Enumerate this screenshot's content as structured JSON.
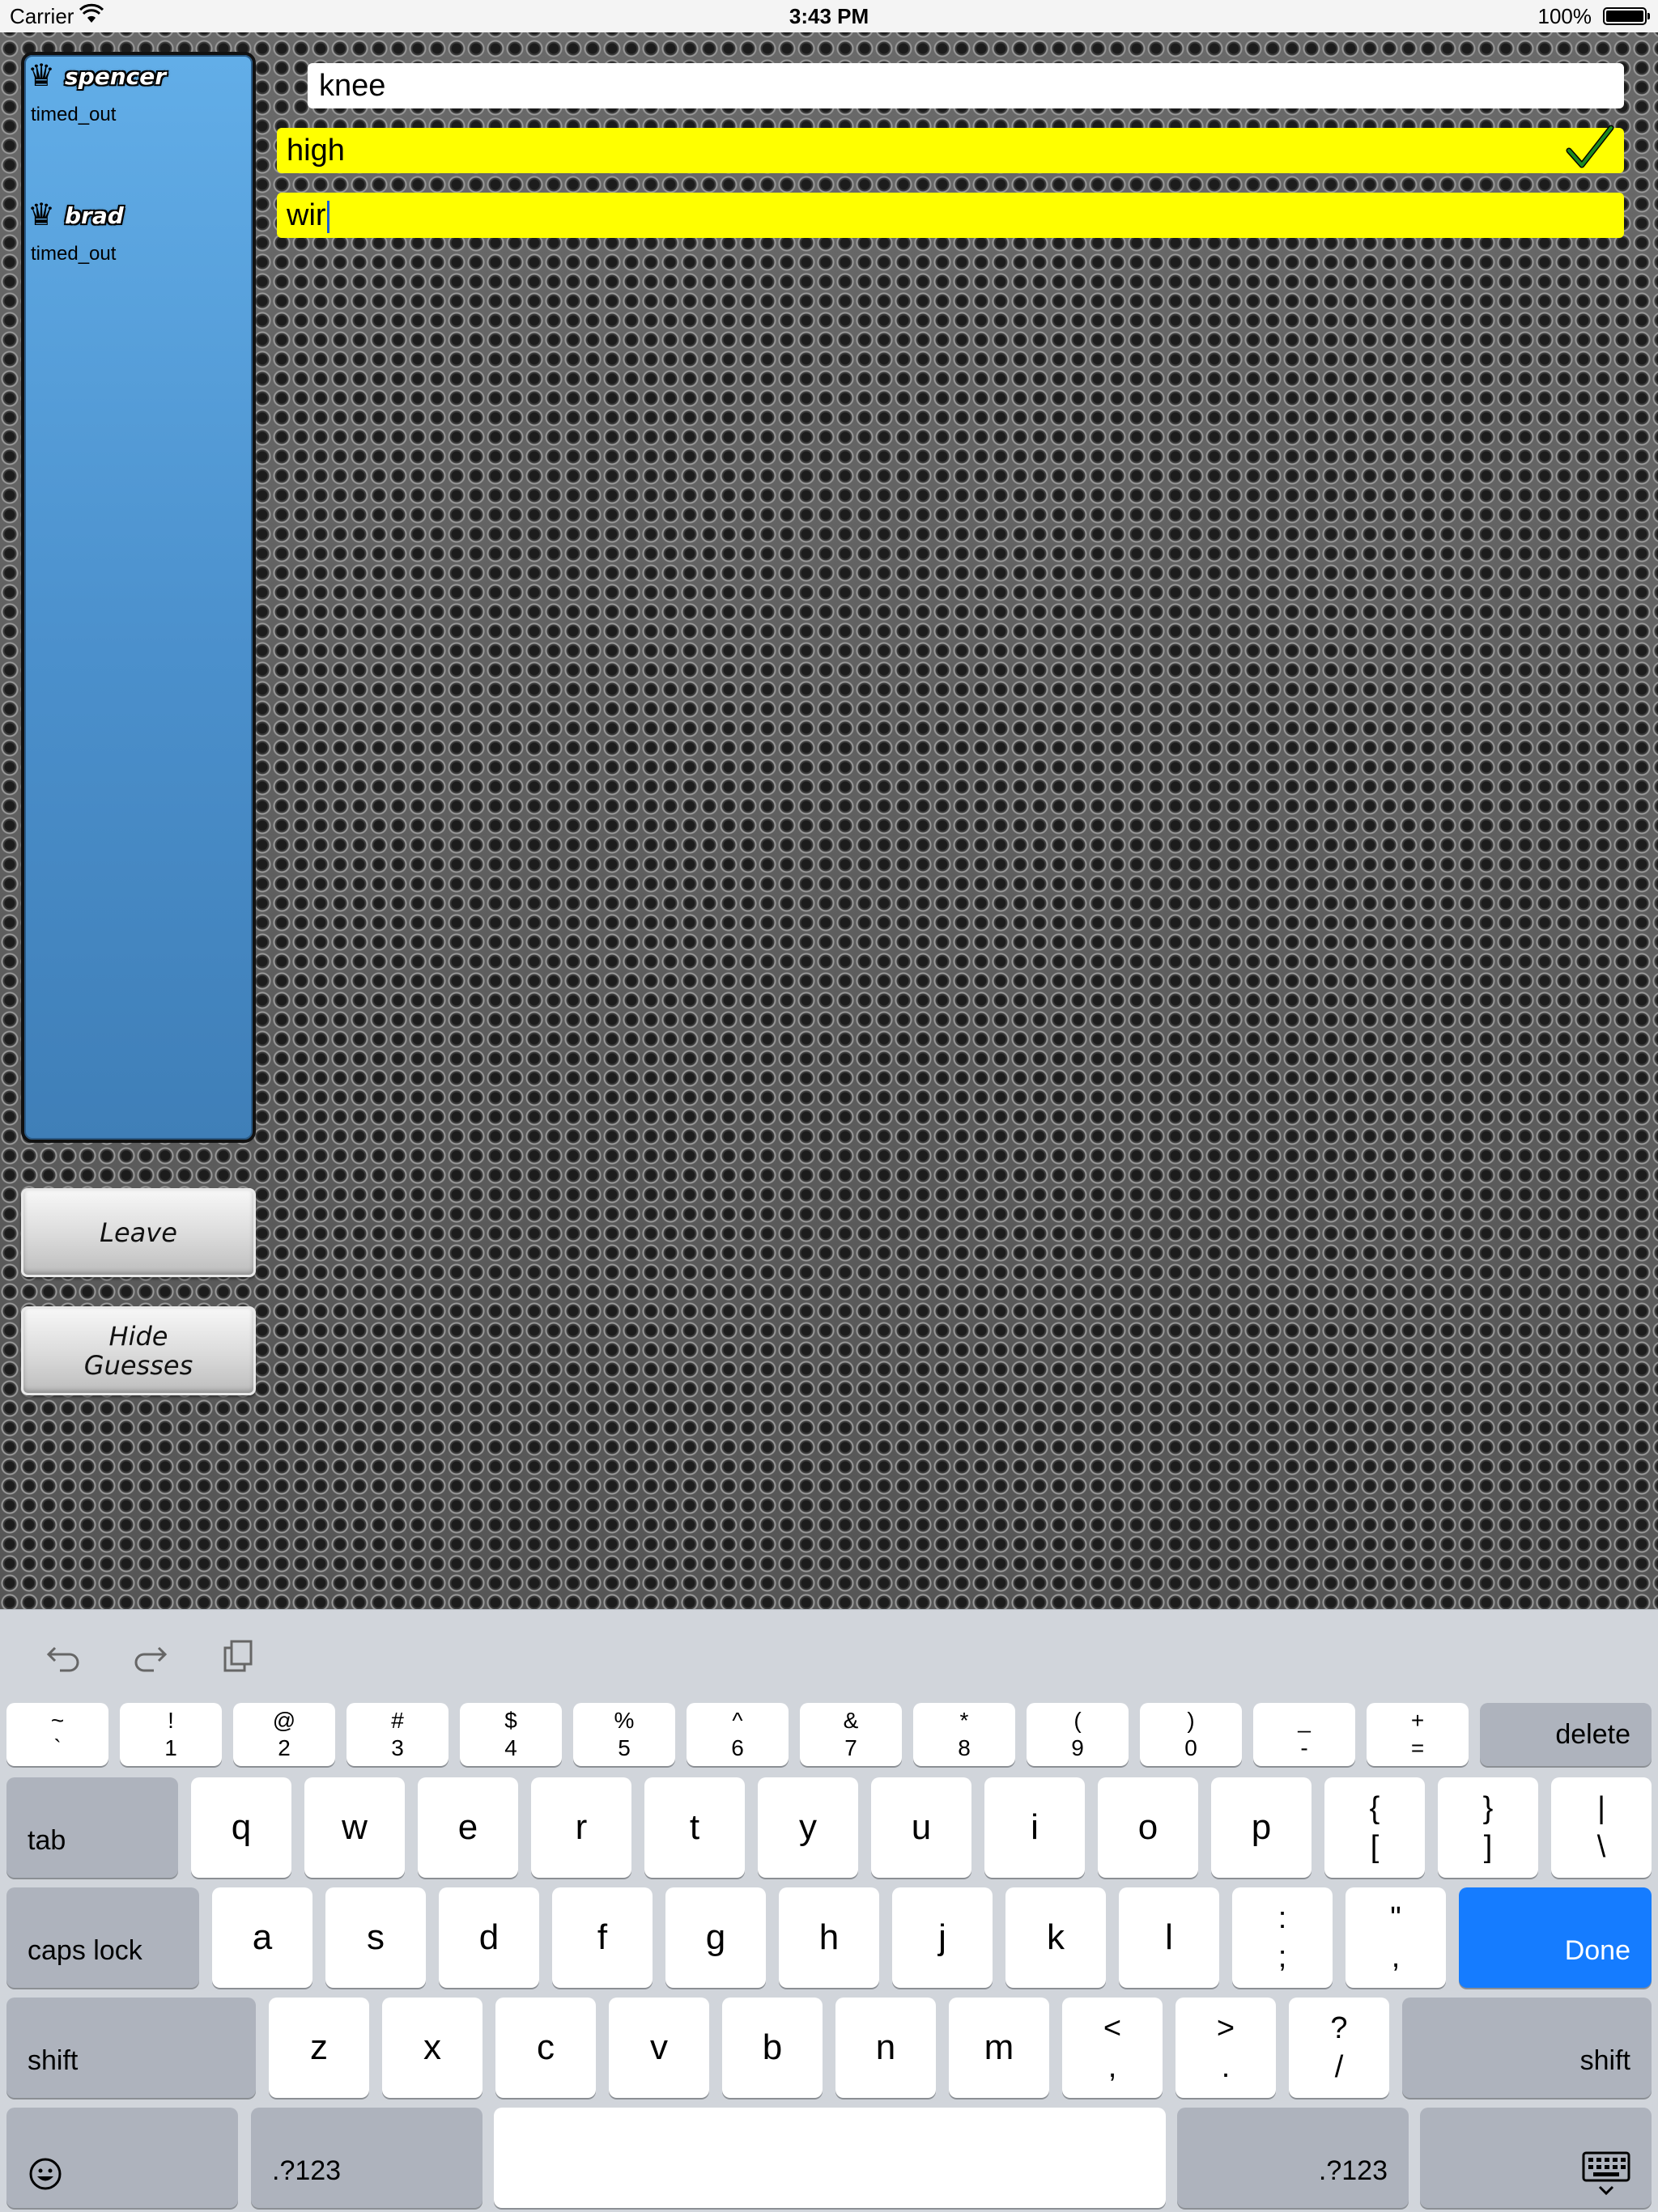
{
  "status_bar": {
    "carrier": "Carrier",
    "time": "3:43 PM",
    "battery": "100%"
  },
  "players": [
    {
      "name": "spencer",
      "status": "timed_out"
    },
    {
      "name": "brad",
      "status": "timed_out"
    }
  ],
  "buttons": {
    "leave": "Leave",
    "hide_guesses_line1": "Hide",
    "hide_guesses_line2": "Guesses"
  },
  "words": [
    {
      "text": "knee",
      "style": "white",
      "checked": false
    },
    {
      "text": "high",
      "style": "yellow",
      "checked": true
    },
    {
      "text": "wir",
      "style": "yellow",
      "checked": false,
      "editing": true
    }
  ],
  "colors": {
    "highlight": "#ffff00",
    "panel": "#4b90cc",
    "done_key": "#157cff",
    "check": "#1e8a1e"
  },
  "keyboard": {
    "num_row": [
      {
        "top": "~",
        "bottom": "`"
      },
      {
        "top": "!",
        "bottom": "1"
      },
      {
        "top": "@",
        "bottom": "2"
      },
      {
        "top": "#",
        "bottom": "3"
      },
      {
        "top": "$",
        "bottom": "4"
      },
      {
        "top": "%",
        "bottom": "5"
      },
      {
        "top": "^",
        "bottom": "6"
      },
      {
        "top": "&",
        "bottom": "7"
      },
      {
        "top": "*",
        "bottom": "8"
      },
      {
        "top": "(",
        "bottom": "9"
      },
      {
        "top": ")",
        "bottom": "0"
      },
      {
        "top": "_",
        "bottom": "-"
      },
      {
        "top": "+",
        "bottom": "="
      }
    ],
    "delete": "delete",
    "tab": "tab",
    "row1": [
      "q",
      "w",
      "e",
      "r",
      "t",
      "y",
      "u",
      "i",
      "o",
      "p"
    ],
    "row1_sym": [
      {
        "top": "{",
        "bottom": "["
      },
      {
        "top": "}",
        "bottom": "]"
      },
      {
        "top": "|",
        "bottom": "\\"
      }
    ],
    "caps_lock": "caps lock",
    "row2": [
      "a",
      "s",
      "d",
      "f",
      "g",
      "h",
      "j",
      "k",
      "l"
    ],
    "row2_sym": [
      {
        "top": ":",
        "bottom": ";"
      },
      {
        "top": "\"",
        "bottom": ","
      }
    ],
    "done": "Done",
    "shift": "shift",
    "row3": [
      "z",
      "x",
      "c",
      "v",
      "b",
      "n",
      "m"
    ],
    "row3_sym": [
      {
        "top": "<",
        "bottom": ","
      },
      {
        "top": ">",
        "bottom": "."
      },
      {
        "top": "?",
        "bottom": "/"
      }
    ],
    "numbers": ".?123",
    "icons": {
      "undo": "undo-icon",
      "redo": "redo-icon",
      "paste": "paste-icon",
      "emoji": "emoji-icon",
      "hide_keyboard": "keyboard-dismiss-icon"
    }
  }
}
